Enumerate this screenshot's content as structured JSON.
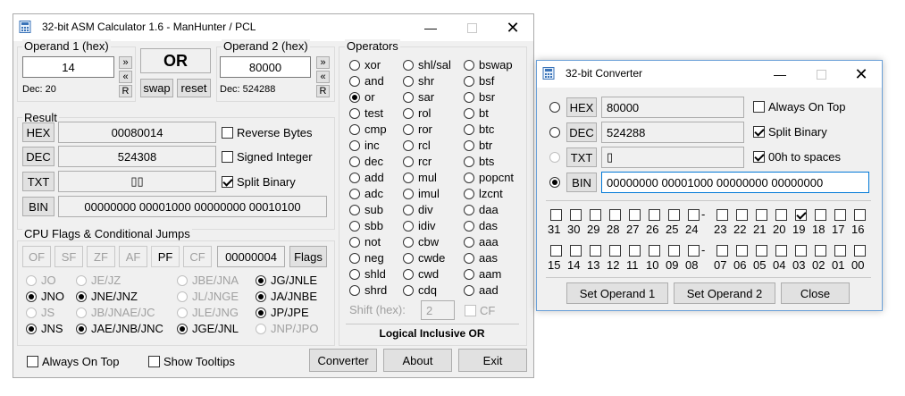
{
  "main": {
    "title": "32-bit ASM Calculator 1.6 - ManHunter / PCL",
    "operand1": {
      "label": "Operand 1 (hex)",
      "value": "14",
      "dec": "Dec: 20"
    },
    "operand2": {
      "label": "Operand 2 (hex)",
      "value": "80000",
      "dec": "Dec: 524288"
    },
    "side_buttons": {
      "right": "»",
      "left": "«",
      "reset": "R"
    },
    "op_display": "OR",
    "swap": "swap",
    "reset": "reset",
    "result": {
      "label": "Result",
      "hex_label": "HEX",
      "hex": "00080014",
      "dec_label": "DEC",
      "dec": "524308",
      "txt_label": "TXT",
      "txt": "▯▯",
      "bin_label": "BIN",
      "bin": "00000000 00001000 00000000 00010100",
      "reverse_bytes": "Reverse Bytes",
      "signed_integer": "Signed Integer",
      "split_binary": "Split Binary"
    },
    "flags": {
      "label": "CPU Flags & Conditional Jumps",
      "items": [
        "OF",
        "SF",
        "ZF",
        "AF",
        "PF",
        "CF"
      ],
      "value": "00000004",
      "button": "Flags"
    },
    "jumps": [
      [
        "JO",
        "JE/JZ",
        "JBE/JNA",
        "JG/JNLE"
      ],
      [
        "JNO",
        "JNE/JNZ",
        "JL/JNGE",
        "JA/JNBE"
      ],
      [
        "JS",
        "JB/JNAE/JC",
        "JLE/JNG",
        "JP/JPE"
      ],
      [
        "JNS",
        "JAE/JNB/JNC",
        "JGE/JNL",
        "JNP/JPO"
      ]
    ],
    "operators": {
      "label": "Operators",
      "col1": [
        "xor",
        "and",
        "or",
        "test",
        "cmp",
        "inc",
        "dec",
        "add",
        "adc",
        "sub",
        "sbb",
        "not",
        "neg",
        "shld",
        "shrd"
      ],
      "col2": [
        "shl/sal",
        "shr",
        "sar",
        "rol",
        "ror",
        "rcl",
        "rcr",
        "mul",
        "imul",
        "div",
        "idiv",
        "cbw",
        "cwde",
        "cwd",
        "cdq"
      ],
      "col3": [
        "bswap",
        "bsf",
        "bsr",
        "bt",
        "btc",
        "btr",
        "bts",
        "popcnt",
        "lzcnt",
        "daa",
        "das",
        "aaa",
        "aas",
        "aam",
        "aad"
      ],
      "shift_label": "Shift (hex):",
      "shift_value": "2",
      "cf": "CF",
      "description": "Logical Inclusive OR"
    },
    "always_on_top": "Always On Top",
    "show_tooltips": "Show Tooltips",
    "converter_btn": "Converter",
    "about_btn": "About",
    "exit_btn": "Exit"
  },
  "converter": {
    "title": "32-bit Converter",
    "hex_label": "HEX",
    "hex": "80000",
    "dec_label": "DEC",
    "dec": "524288",
    "txt_label": "TXT",
    "txt": "▯",
    "bin_label": "BIN",
    "bin": "00000000 00001000 00000000 00000000",
    "always_on_top": "Always On Top",
    "split_binary": "Split Binary",
    "zero_to_spaces": "00h to spaces",
    "bits_high": [
      "31",
      "30",
      "29",
      "28",
      "27",
      "26",
      "25",
      "24",
      "23",
      "22",
      "21",
      "20",
      "19",
      "18",
      "17",
      "16"
    ],
    "bits_low": [
      "15",
      "14",
      "13",
      "12",
      "11",
      "10",
      "09",
      "08",
      "07",
      "06",
      "05",
      "04",
      "03",
      "02",
      "01",
      "00"
    ],
    "dash": "-",
    "set_op1": "Set Operand 1",
    "set_op2": "Set Operand 2",
    "close": "Close"
  },
  "icons": {
    "app": "calculator-icon",
    "minimize": "minimize-icon",
    "maximize": "maximize-icon",
    "close": "close-icon"
  }
}
